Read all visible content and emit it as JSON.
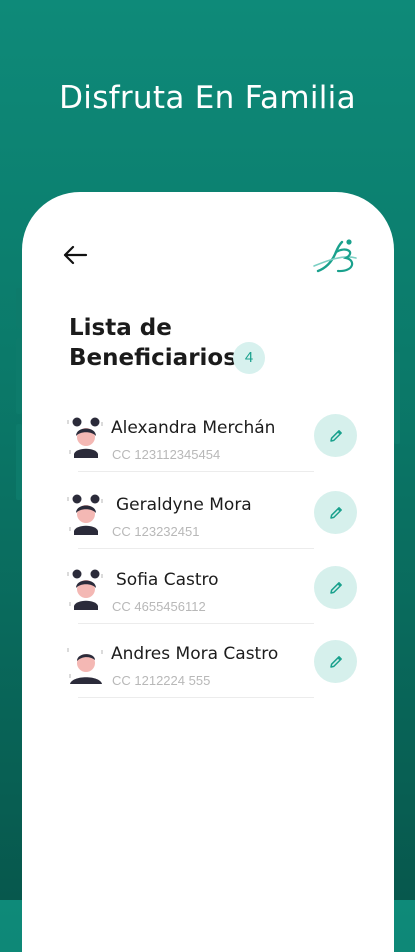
{
  "hero": {
    "title": "Disfruta En Familia"
  },
  "colors": {
    "accent": "#1aa18d",
    "accent_light": "#d6f0ec",
    "background": "#0b7a6a"
  },
  "screen": {
    "title_line1": "Lista de",
    "title_line2": "Beneficiarios",
    "count": "4"
  },
  "beneficiaries": [
    {
      "name": "Alexandra Merchán",
      "document": "CC 123112345454",
      "avatar": "female-avatar-icon"
    },
    {
      "name": "Geraldyne Mora",
      "document": "CC 123232451",
      "avatar": "female-avatar-icon"
    },
    {
      "name": "Sofia Castro",
      "document": "CC 4655456112",
      "avatar": "female-avatar-icon"
    },
    {
      "name": "Andres Mora Castro",
      "document": "CC 1212224 555",
      "avatar": "male-avatar-icon"
    }
  ]
}
